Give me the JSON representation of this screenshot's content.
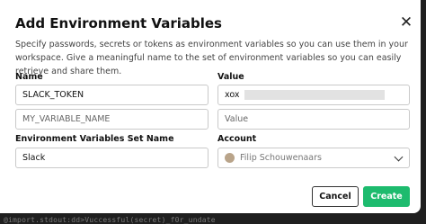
{
  "dialog": {
    "title": "Add Environment Variables",
    "description": "Specify passwords, secrets or tokens as environment variables so you can use them in your workspace. Give a meaningful name to the set of environment variables so you can easily retrieve and share them."
  },
  "labels": {
    "name": "Name",
    "value": "Value",
    "set_name": "Environment Variables Set Name",
    "account": "Account"
  },
  "rows": [
    {
      "name": "SLACK_TOKEN",
      "value": "xox",
      "value_masked": true
    },
    {
      "name_placeholder": "MY_VARIABLE_NAME",
      "value_placeholder": "Value"
    }
  ],
  "set_name_value": "Slack",
  "account": {
    "selected": "Filip Schouwenaars"
  },
  "buttons": {
    "cancel": "Cancel",
    "create": "Create"
  },
  "backdrop_text": "@import.stdout:dd>Vuccessful(secret)_f0r_undate",
  "colors": {
    "primary": "#1dbb6e"
  }
}
